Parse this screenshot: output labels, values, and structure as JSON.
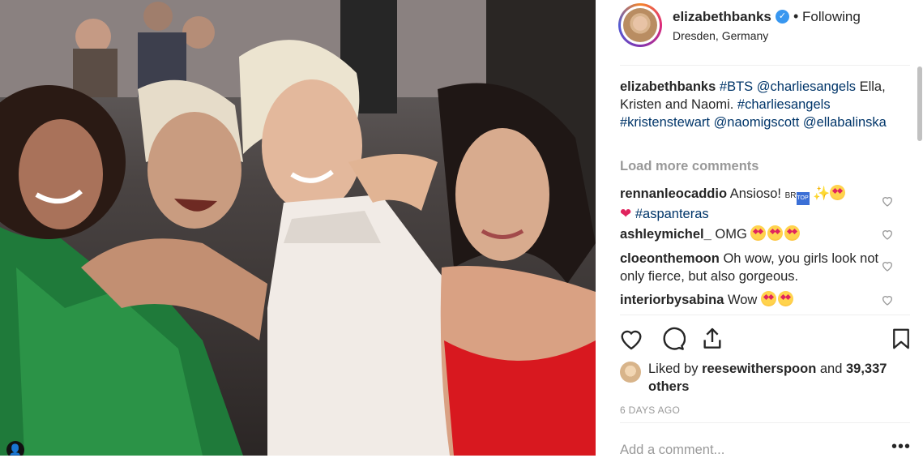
{
  "post": {
    "photo_tag_icon": "person-tag-icon"
  },
  "header": {
    "username": "elizabethbanks",
    "verified_icon": "verified-badge-icon",
    "separator": "•",
    "follow_status": "Following",
    "location": "Dresden, Germany"
  },
  "caption": {
    "username": "elizabethbanks",
    "parts": [
      "#BTS",
      "@charliesangels",
      "Ella, Kristen and Naomi.",
      "#charliesangels",
      "#kristenstewart",
      "@naomigscott",
      "@ellabalinska"
    ]
  },
  "load_more": "Load more comments",
  "comments": [
    {
      "username": "rennanleocaddio",
      "text": "Ansioso!",
      "small_text": "BR",
      "badge_text": "TOP",
      "hashtag": "#aspanteras"
    },
    {
      "username": "ashleymichel_",
      "text": "OMG"
    },
    {
      "username": "cloeonthemoon",
      "text": "Oh wow, you girls look not only fierce, but also gorgeous."
    },
    {
      "username": "interiorbysabina",
      "text": "Wow"
    }
  ],
  "likes": {
    "prefix": "Liked by",
    "liker": "reesewitherspoon",
    "and": "and",
    "others": "39,337 others"
  },
  "timestamp": "6 DAYS AGO",
  "add_comment_placeholder": "Add a comment...",
  "more_options": "•••",
  "colors": {
    "link": "#003569",
    "verified": "#3897f0",
    "muted": "#999999"
  }
}
